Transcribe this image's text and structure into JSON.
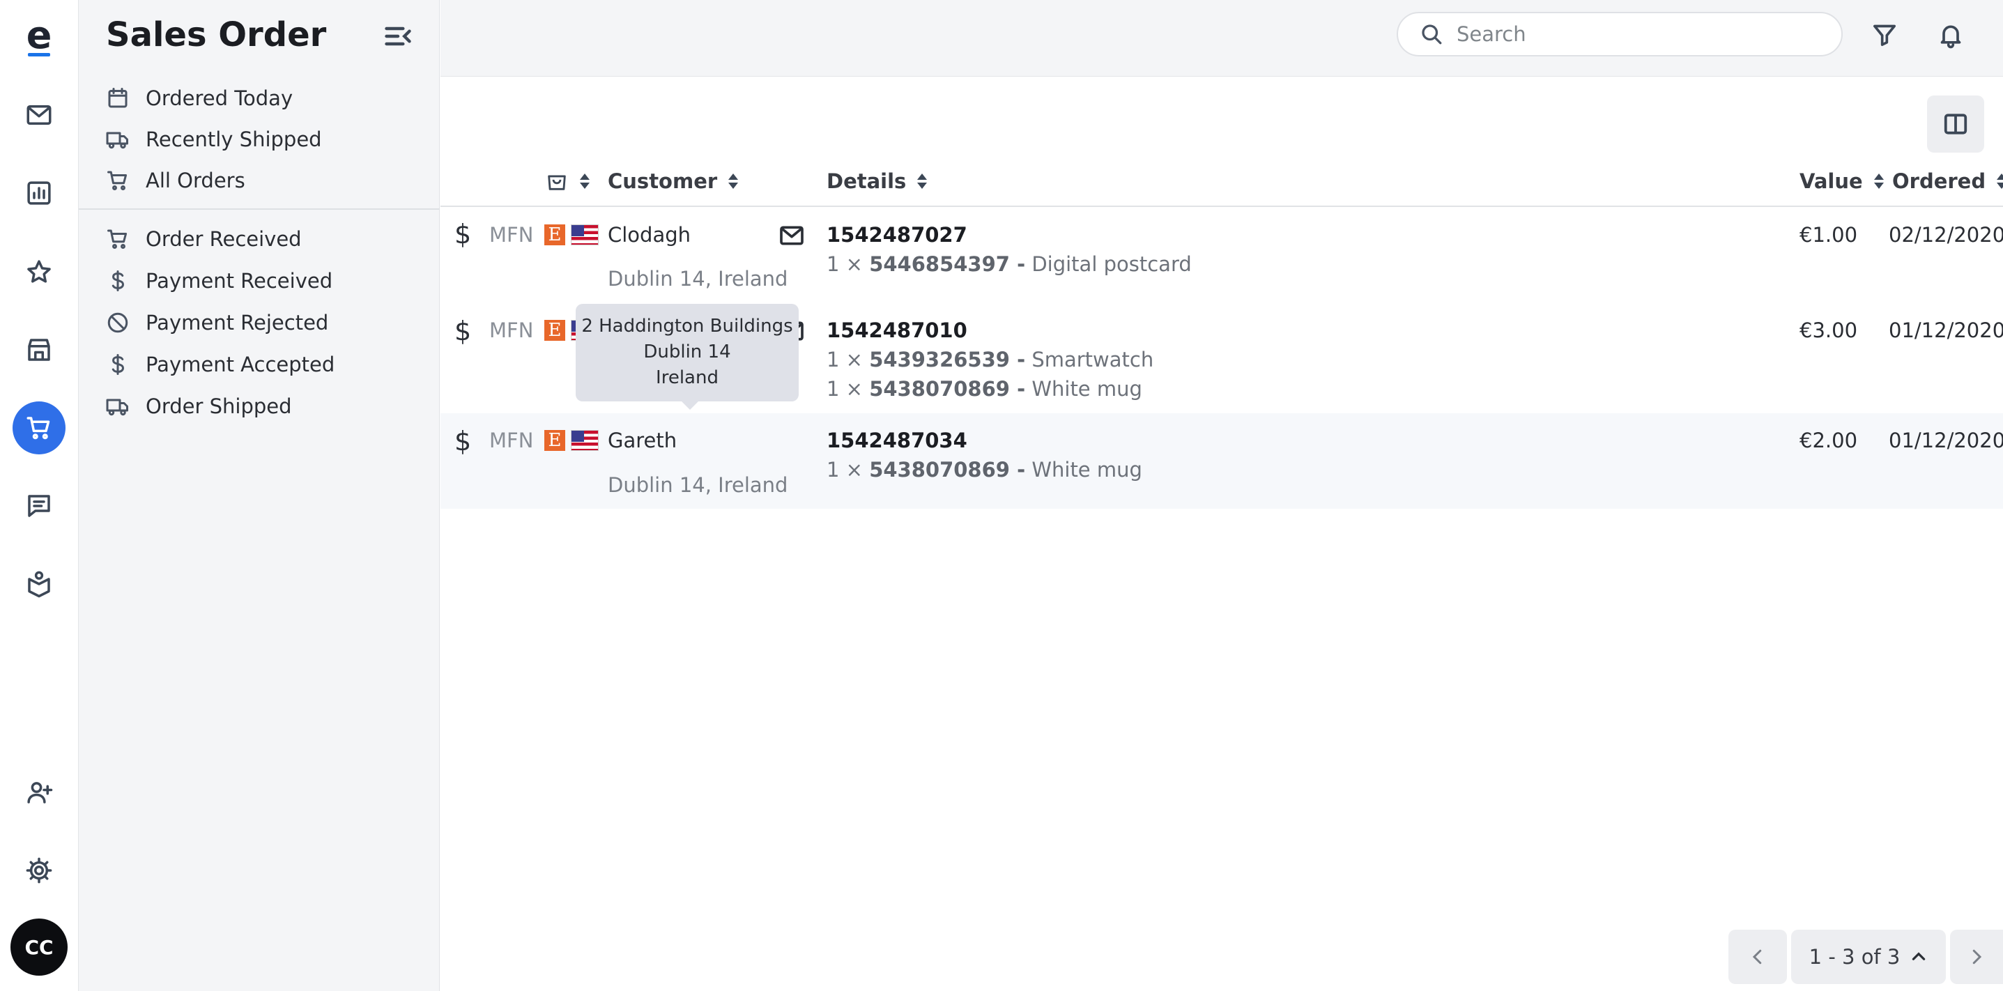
{
  "app": {
    "logo_letter": "e",
    "avatar_initials": "CC"
  },
  "rail": {
    "icons": [
      "mail-icon",
      "chart-icon",
      "star-icon",
      "store-icon",
      "cart-icon",
      "chat-icon",
      "book-icon",
      "add-user-icon",
      "gear-icon"
    ],
    "active": "cart-icon",
    "accent": "#2f6fe8"
  },
  "sidebar": {
    "title": "Sales Order",
    "group1": [
      {
        "label": "Ordered Today",
        "icon": "calendar-icon"
      },
      {
        "label": "Recently Shipped",
        "icon": "truck-icon"
      },
      {
        "label": "All Orders",
        "icon": "cart-icon"
      }
    ],
    "group2": [
      {
        "label": "Order Received",
        "icon": "cart-icon"
      },
      {
        "label": "Payment Received",
        "icon": "dollar-icon"
      },
      {
        "label": "Payment Rejected",
        "icon": "ban-icon"
      },
      {
        "label": "Payment Accepted",
        "icon": "dollar-icon"
      },
      {
        "label": "Order Shipped",
        "icon": "truck-icon"
      }
    ]
  },
  "search": {
    "placeholder": "Search"
  },
  "table": {
    "columns": {
      "customer": "Customer",
      "details": "Details",
      "value": "Value",
      "ordered": "Ordered"
    },
    "rows": [
      {
        "channel": "MFN",
        "currency_icon": "$",
        "marketplace": "E",
        "customer": "Clodagh",
        "address": "Dublin 14, Ireland",
        "order_id": "1542487027",
        "items": [
          {
            "qty": "1 ×",
            "sku": "5446854397 -",
            "name": "Digital postcard"
          }
        ],
        "value": "€1.00",
        "date": "02/12/2020"
      },
      {
        "channel": "MFN",
        "currency_icon": "$",
        "marketplace": "E",
        "customer": "",
        "address": "",
        "order_id": "1542487010",
        "items": [
          {
            "qty": "1 ×",
            "sku": "5439326539 -",
            "name": "Smartwatch"
          },
          {
            "qty": "1 ×",
            "sku": "5438070869 -",
            "name": "White mug"
          }
        ],
        "value": "€3.00",
        "date": "01/12/2020"
      },
      {
        "channel": "MFN",
        "currency_icon": "$",
        "marketplace": "E",
        "customer": "Gareth",
        "address": "Dublin 14, Ireland",
        "order_id": "1542487034",
        "items": [
          {
            "qty": "1 ×",
            "sku": "5438070869 -",
            "name": "White mug"
          }
        ],
        "value": "€2.00",
        "date": "01/12/2020"
      }
    ]
  },
  "tooltip": {
    "line1": "2 Haddington Buildings",
    "line2": "Dublin 14",
    "line3": "Ireland"
  },
  "pager": {
    "label": "1 - 3 of 3"
  }
}
